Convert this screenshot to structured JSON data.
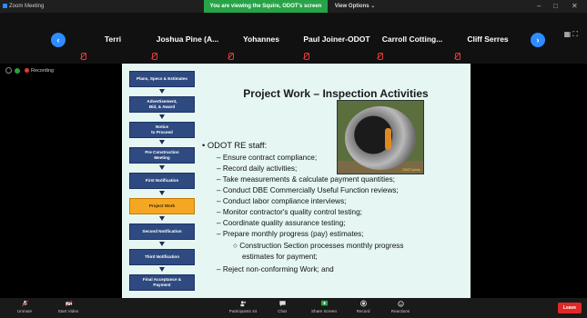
{
  "window": {
    "title": "Zoom Meeting"
  },
  "banner": {
    "share_text": "You are viewing the Squire, ODOT's screen",
    "view_options": "View Options ⌄"
  },
  "participants": [
    {
      "name": "Terri"
    },
    {
      "name": "Joshua Pine (A..."
    },
    {
      "name": "Yohannes"
    },
    {
      "name": "Paul Joiner-ODOT"
    },
    {
      "name": "Carroll Cotting..."
    },
    {
      "name": "Cliff Serres"
    }
  ],
  "recording": {
    "label": "Recording"
  },
  "slide": {
    "title": "Project Work – Inspection Activities",
    "flowchart": [
      {
        "label": "Plans, Specs & Estimates",
        "active": false
      },
      {
        "label": "Advertisement,\nBid, & Award",
        "active": false
      },
      {
        "label": "Notice\nto Proceed",
        "active": false
      },
      {
        "label": "Pre Construction\nMeeting",
        "active": false
      },
      {
        "label": "First Notification",
        "active": false
      },
      {
        "label": "Project Work",
        "active": true
      },
      {
        "label": "Second Notification",
        "active": false
      },
      {
        "label": "Third Notification",
        "active": false
      },
      {
        "label": "Final Acceptance &\nPayment",
        "active": false
      }
    ],
    "heading_bullet": "• ODOT RE staff:",
    "items": [
      "– Ensure contract compliance;",
      "– Record daily activities;",
      "– Take measurements & calculate payment quantities;",
      "– Conduct DBE Commercially Useful Function reviews;",
      "– Conduct labor compliance interviews;",
      "– Monitor contractor's quality control testing;",
      "– Coordinate quality assurance testing;",
      "– Prepare monthly progress (pay) estimates;"
    ],
    "sub_item": "○ Construction Section processes monthly progress",
    "sub_item_cont": "estimates for payment;",
    "last_item": "– Reject non-conforming Work; and",
    "photo_credit": "ODOT photo"
  },
  "toolbar": {
    "unmute": "Unmute",
    "start_video": "Start Video",
    "participants": "Participants",
    "participants_count": "44",
    "chat": "Chat",
    "share_screen": "Share Screen",
    "record": "Record",
    "reactions": "Reactions",
    "leave": "Leave"
  },
  "colors": {
    "accent": "#2d8cff",
    "share_green": "#27a348",
    "leave_red": "#e02828",
    "active_step": "#f5a623",
    "step_blue": "#2e4a80"
  }
}
